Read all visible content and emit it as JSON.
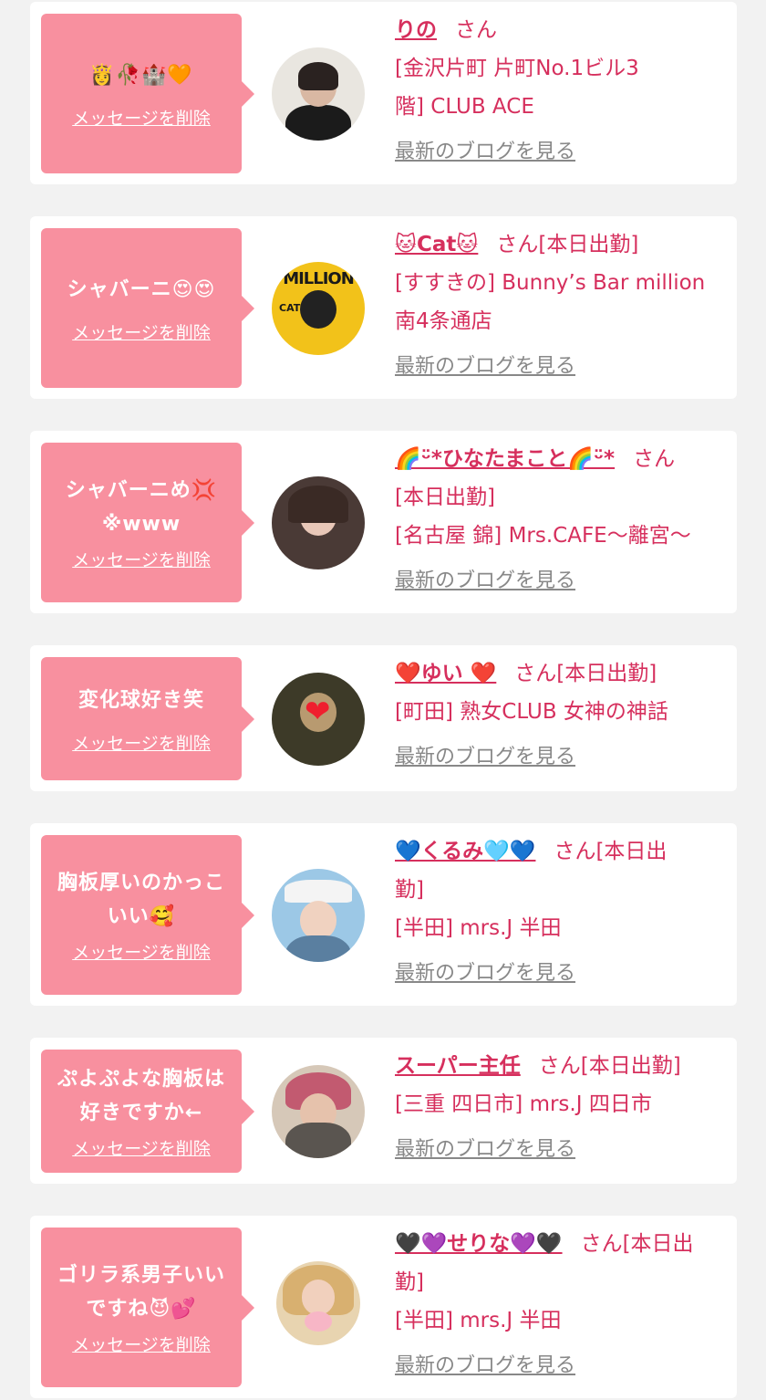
{
  "common": {
    "delete_label": "メッセージを削除",
    "blog_label": "最新のブログを見る"
  },
  "cards": [
    {
      "message": "👸🥀🏰🧡",
      "name": "りの",
      "suffix": "さん",
      "shop_lines": [
        "[金沢片町 片町No.1ビル3",
        "階] CLUB ACE"
      ]
    },
    {
      "message": "シャバーニ😍😍",
      "name": "🐱Cat🐱",
      "suffix": "さん[本日出勤]",
      "shop_lines": [
        "[すすきの] Bunny’s Bar million",
        "南4条通店"
      ],
      "avatar_text": "MILLION",
      "avatar_label": "CAT"
    },
    {
      "message_lines": [
        "シャバーニめ💢",
        "※www"
      ],
      "name": "🌈ᵕ̈*ひなたまこと🌈ᵕ̈*",
      "suffix": "さん",
      "shop_lines": [
        "[本日出勤]",
        "[名古屋 錦] Mrs.CAFE～離宮～"
      ]
    },
    {
      "message": "変化球好き笑",
      "name": "❤️ゆい ❤️",
      "suffix": "さん[本日出勤]",
      "shop_lines": [
        "[町田] 熟女CLUB 女神の神話"
      ]
    },
    {
      "message_lines": [
        "胸板厚いのかっこ",
        "いい🥰"
      ],
      "name": "💙くるみ🩵💙",
      "suffix": "さん[本日出",
      "shop_lines": [
        "勤]",
        "[半田] mrs.J 半田"
      ]
    },
    {
      "message_lines": [
        "ぷよぷよな胸板は",
        "好きですか←"
      ],
      "name": "スーパー主任",
      "suffix": "さん[本日出勤]",
      "shop_lines": [
        "[三重 四日市] mrs.J 四日市"
      ]
    },
    {
      "message_lines": [
        "ゴリラ系男子いい",
        "ですね😈💕"
      ],
      "name": "🖤💜せりな💜🖤",
      "suffix": "さん[本日出",
      "shop_lines": [
        "勤]",
        "[半田] mrs.J 半田"
      ]
    }
  ]
}
